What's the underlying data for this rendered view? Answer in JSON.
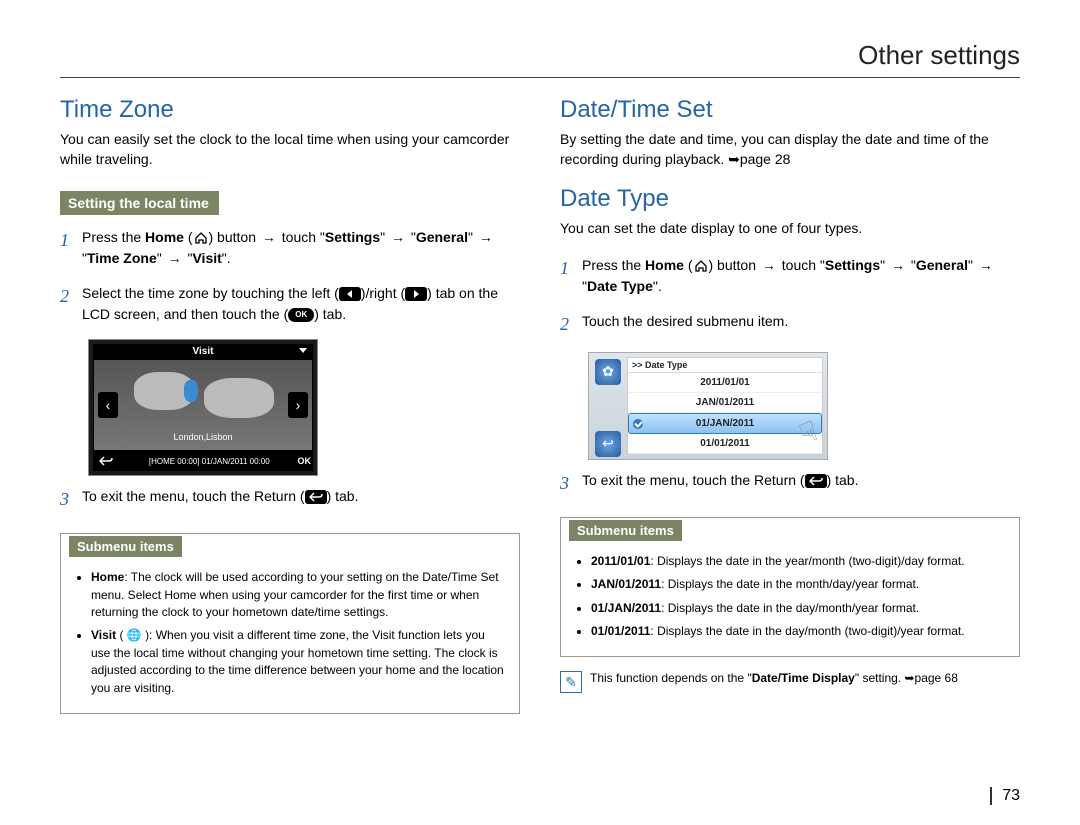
{
  "header": {
    "title": "Other settings"
  },
  "page_number": "73",
  "left": {
    "title": "Time Zone",
    "lead": "You can easily set the clock to the local time when using your camcorder while traveling.",
    "sub_bar": "Setting the local time",
    "steps": {
      "s1": {
        "a": "Press the ",
        "home": "Home",
        "b": " (",
        "c": ") button ",
        "arr": "→",
        "d": " touch \"",
        "settings": "Settings",
        "e": "\" ",
        "f": " \"",
        "general": "General",
        "g": "\" ",
        "h": " \"",
        "tz": "Time Zone",
        "i": "\" ",
        "j": " \"",
        "visit": "Visit",
        "k": "\"."
      },
      "s2": {
        "a": "Select the time zone by touching the left (",
        "b": ")/right (",
        "c": ") tab on the LCD screen, and then touch the (",
        "d": ") tab."
      },
      "s3": {
        "a": "To exit the menu, touch the Return (",
        "b": ") tab."
      }
    },
    "lcd": {
      "top": "Visit",
      "city": "London,Lisbon",
      "info": "[HOME 00:00] 01/JAN/2011 00:00",
      "ok": "OK"
    },
    "submenu": {
      "head": "Submenu items",
      "items": {
        "home_lbl": "Home",
        "home_txt": ": The clock will be used according to your setting on the Date/Time Set menu. Select Home when using your camcorder for the first time or when returning the clock to your hometown date/time settings.",
        "visit_lbl": "Visit",
        "visit_txt": " ( 🌐 ): When you visit a different time zone, the Visit function lets you use the local time without changing your hometown time setting. The clock is adjusted according to the time difference between your home and the location you are visiting."
      }
    }
  },
  "right": {
    "title1": "Date/Time Set",
    "lead1": "By setting the date and time, you can display the date and time of the recording during playback. ➥page 28",
    "title2": "Date Type",
    "lead2": "You can set the date display to one of four types.",
    "steps": {
      "s1": {
        "a": "Press the ",
        "home": "Home",
        "b": " (",
        "c": ") button ",
        "arr": "→",
        "d": " touch \"",
        "settings": "Settings",
        "e": "\" ",
        "f": " \"",
        "general": "General",
        "g": "\" ",
        "h": " \"",
        "dt": "Date Type",
        "i": "\"."
      },
      "s2": {
        "a": "Touch the desired submenu item."
      },
      "s3": {
        "a": "To exit the menu, touch the Return (",
        "b": ") tab."
      }
    },
    "lcd": {
      "title": ">> Date Type",
      "opt1": "2011/01/01",
      "opt2": "JAN/01/2011",
      "opt3": "01/JAN/2011",
      "opt4": "01/01/2011"
    },
    "submenu": {
      "head": "Submenu items",
      "items": {
        "a_lbl": "2011/01/01",
        "a_txt": ": Displays the date in the year/month (two-digit)/day format.",
        "b_lbl": "JAN/01/2011",
        "b_txt": ": Displays the date in the month/day/year format.",
        "c_lbl": "01/JAN/2011",
        "c_txt": ": Displays the date in the day/month/year format.",
        "d_lbl": "01/01/2011",
        "d_txt": ": Displays the date in the day/month (two-digit)/year format."
      }
    },
    "note": {
      "a": "This function depends on the \"",
      "b": "Date/Time Display",
      "c": "\" setting. ➥page 68"
    }
  }
}
